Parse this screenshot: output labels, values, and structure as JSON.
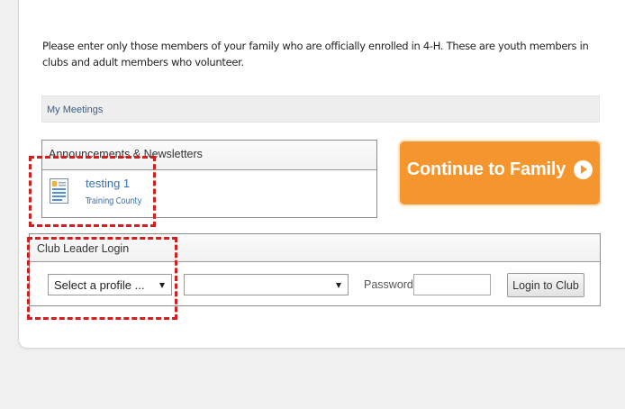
{
  "intro_text": "Please enter only those members of your family who are officially enrolled in 4-H. These are youth members in clubs and adult members who volunteer.",
  "meetings": {
    "link_label": "My Meetings"
  },
  "announcements": {
    "header": "Announcements & Newsletters",
    "items": [
      {
        "title": "testing 1",
        "subtitle": "Training County",
        "icon": "document-icon"
      }
    ]
  },
  "continue_button": {
    "label": "Continue to Family",
    "icon": "circle-arrow-right-icon"
  },
  "club_login": {
    "header": "Club Leader Login",
    "profile_select": {
      "selected": "Select a profile ..."
    },
    "club_select": {
      "selected": ""
    },
    "password_label": "Password:",
    "password_value": "",
    "login_button": "Login to Club"
  },
  "colors": {
    "accent_orange": "#f4952e",
    "link_blue": "#3a6fb0",
    "highlight_red": "#d41e1e"
  }
}
